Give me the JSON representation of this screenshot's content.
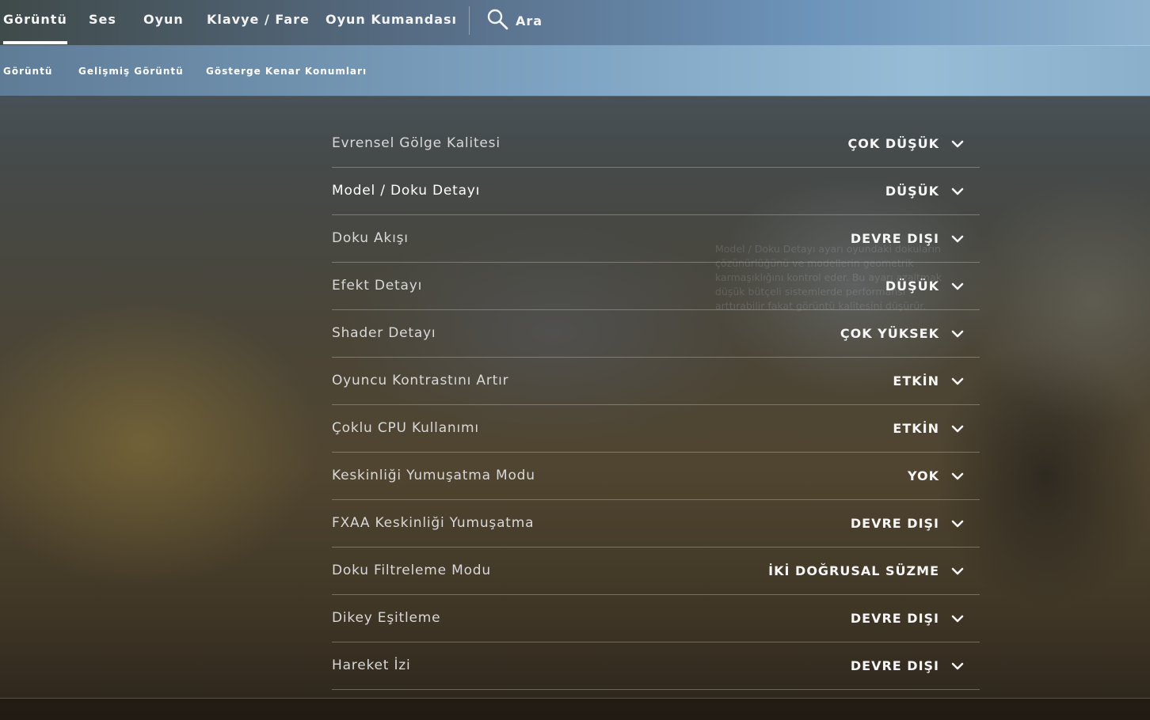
{
  "top_nav": {
    "tabs": [
      {
        "label": "Görüntü",
        "active": true
      },
      {
        "label": "Ses",
        "active": false
      },
      {
        "label": "Oyun",
        "active": false
      },
      {
        "label": "Klavye / Fare",
        "active": false
      },
      {
        "label": "Oyun Kumandası",
        "active": false
      }
    ],
    "search": {
      "label": "Ara",
      "icon": "search-icon"
    }
  },
  "sub_nav": {
    "tabs": [
      {
        "label": "Görüntü"
      },
      {
        "label": "Gelişmiş Görüntü"
      },
      {
        "label": "Gösterge Kenar Konumları"
      }
    ]
  },
  "settings": [
    {
      "label": "Evrensel Gölge Kalitesi",
      "value": "ÇOK DÜŞÜK"
    },
    {
      "label": "Model / Doku Detayı",
      "value": "DÜŞÜK",
      "highlighted": true
    },
    {
      "label": "Doku Akışı",
      "value": "DEVRE DIŞI"
    },
    {
      "label": "Efekt Detayı",
      "value": "DÜŞÜK"
    },
    {
      "label": "Shader Detayı",
      "value": "ÇOK YÜKSEK"
    },
    {
      "label": "Oyuncu Kontrastını Artır",
      "value": "ETKİN"
    },
    {
      "label": "Çoklu CPU Kullanımı",
      "value": "ETKİN"
    },
    {
      "label": "Keskinliği Yumuşatma Modu",
      "value": "YOK"
    },
    {
      "label": "FXAA Keskinliği Yumuşatma",
      "value": "DEVRE DIŞI"
    },
    {
      "label": "Doku Filtreleme Modu",
      "value": "İKİ DOĞRUSAL SÜZME"
    },
    {
      "label": "Dikey Eşitleme",
      "value": "DEVRE DIŞI"
    },
    {
      "label": "Hareket İzi",
      "value": "DEVRE DIŞI"
    }
  ],
  "tooltip": {
    "text": "Model / Doku Detayı ayarı oyundaki dokuların çözünürlüğünü ve modellerin geometrik karmaşıklığını kontrol eder. Bu ayarı azaltmak düşük bütçeli sistemlerde performansı arttırabilir fakat görüntü kalitesini düşürür."
  },
  "colors": {
    "nav_gradient_end": "#8fb3cf",
    "active_underline": "#ffffff",
    "row_divider": "rgba(255,255,255,0.28)"
  }
}
